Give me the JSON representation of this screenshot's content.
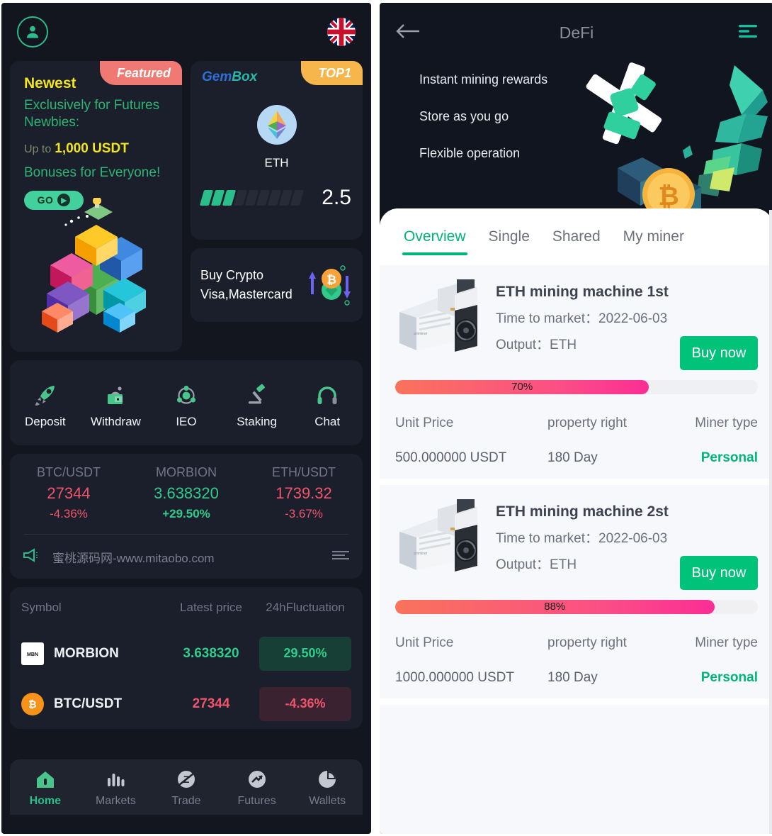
{
  "left": {
    "topbar": {
      "avatar_icon": "user-avatar-icon",
      "language_icon": "uk-flag-icon"
    },
    "promo": {
      "ribbon": "Featured",
      "newest": "Newest",
      "headline_1": "Exclusively for Futures",
      "headline_2": "Newbies:",
      "upto_prefix": "Up to",
      "upto_amount": "1,000 USDT",
      "bonus_line": "Bonuses for Everyone!",
      "cta": "GO"
    },
    "gembox": {
      "brand_gem": "Gem",
      "brand_box": "Box",
      "ribbon": "TOP1",
      "symbol": "ETH",
      "value": "2.5",
      "segments_total": 9,
      "segments_filled": 3
    },
    "buy_crypto": {
      "line1": "Buy Crypto",
      "line2": "Visa,Mastercard"
    },
    "actions": [
      {
        "label": "Deposit",
        "icon": "rocket-icon"
      },
      {
        "label": "Withdraw",
        "icon": "withdraw-wallet-icon"
      },
      {
        "label": "IEO",
        "icon": "atom-icon"
      },
      {
        "label": "Staking",
        "icon": "gavel-icon"
      },
      {
        "label": "Chat",
        "icon": "headset-icon"
      }
    ],
    "tickers": [
      {
        "name": "BTC/USDT",
        "price": "27344",
        "change": "-4.36%",
        "dir": "down",
        "strong": false
      },
      {
        "name": "MORBION",
        "price": "3.638320",
        "change": "+29.50%",
        "dir": "up",
        "strong": true
      },
      {
        "name": "ETH/USDT",
        "price": "1739.32",
        "change": "-3.67%",
        "dir": "down",
        "strong": false
      }
    ],
    "announcement": {
      "icon": "megaphone-icon",
      "text": "蜜桃源码网-www.mitaobo.com",
      "more_icon": "list-more-icon"
    },
    "market_table": {
      "headers": [
        "Symbol",
        "Latest price",
        "24hFluctuation"
      ],
      "rows": [
        {
          "icon": "morbion-logo-icon",
          "symbol": "MORBION",
          "price": "3.638320",
          "change": "29.50%",
          "dir": "up"
        },
        {
          "icon": "bitcoin-logo-icon",
          "symbol": "BTC/USDT",
          "price": "27344",
          "change": "-4.36%",
          "dir": "down"
        }
      ]
    },
    "tabbar": [
      {
        "label": "Home",
        "icon": "home-icon",
        "active": true
      },
      {
        "label": "Markets",
        "icon": "bars-icon",
        "active": false
      },
      {
        "label": "Trade",
        "icon": "trade-icon",
        "active": false
      },
      {
        "label": "Futures",
        "icon": "trend-icon",
        "active": false
      },
      {
        "label": "Wallets",
        "icon": "pie-icon",
        "active": false
      }
    ],
    "colors": {
      "accent": "#2bbd8a",
      "up": "#2fcc8b",
      "down": "#f0556b",
      "bg": "#13161f",
      "card": "#1b1f2b"
    }
  },
  "right": {
    "header": {
      "back_icon": "back-arrow-icon",
      "title": "DeFi",
      "menu_icon": "hamburger-menu-icon"
    },
    "hero": {
      "bullets": [
        "Instant mining rewards",
        "Store as you go",
        "Flexible operation"
      ],
      "art_icon": "pickaxe-bitcoin-illustration"
    },
    "tabs": [
      {
        "label": "Overview",
        "active": true
      },
      {
        "label": "Single",
        "active": false
      },
      {
        "label": "Shared",
        "active": false
      },
      {
        "label": "My miner",
        "active": false
      }
    ],
    "column_headers": [
      "Unit Price",
      "property right",
      "Miner type"
    ],
    "miners": [
      {
        "title": "ETH mining machine 1st",
        "time_label": "Time to market：",
        "time_value": "2022-06-03",
        "output_label": "Output：",
        "output_value": "ETH",
        "buy_label": "Buy now",
        "progress": "70%",
        "progress_value": 70,
        "unit_price": "500.000000 USDT",
        "property_right": "180 Day",
        "miner_type": "Personal",
        "thumb_icon": "mining-rig-icon"
      },
      {
        "title": "ETH mining machine 2st",
        "time_label": "Time to market：",
        "time_value": "2022-06-03",
        "output_label": "Output：",
        "output_value": "ETH",
        "buy_label": "Buy now",
        "progress": "88%",
        "progress_value": 88,
        "unit_price": "1000.000000 USDT",
        "property_right": "180 Day",
        "miner_type": "Personal",
        "thumb_icon": "mining-rig-icon"
      }
    ],
    "colors": {
      "accent": "#00b578",
      "buy": "#00c278",
      "sheet_bg": "#f7f8fb"
    }
  }
}
